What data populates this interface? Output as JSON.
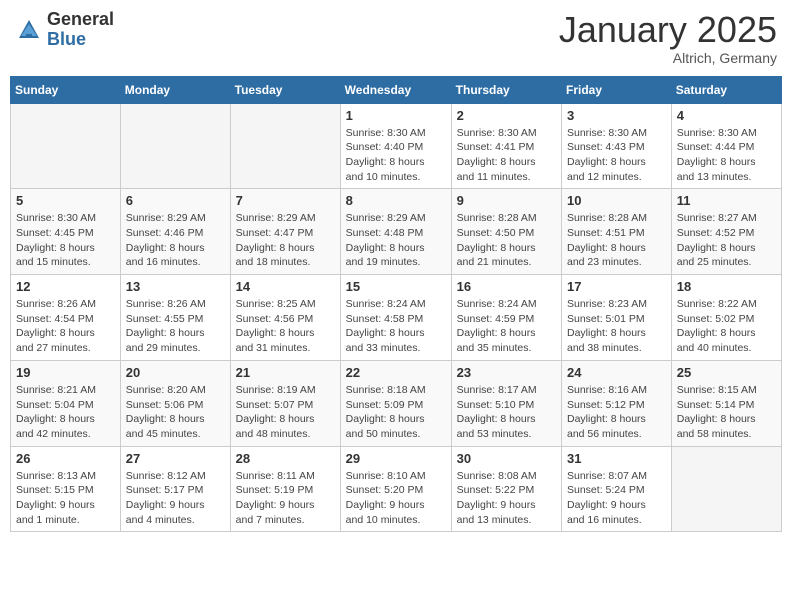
{
  "header": {
    "logo_general": "General",
    "logo_blue": "Blue",
    "month_year": "January 2025",
    "location": "Altrich, Germany"
  },
  "weekdays": [
    "Sunday",
    "Monday",
    "Tuesday",
    "Wednesday",
    "Thursday",
    "Friday",
    "Saturday"
  ],
  "weeks": [
    [
      {
        "day": "",
        "info": ""
      },
      {
        "day": "",
        "info": ""
      },
      {
        "day": "",
        "info": ""
      },
      {
        "day": "1",
        "info": "Sunrise: 8:30 AM\nSunset: 4:40 PM\nDaylight: 8 hours\nand 10 minutes."
      },
      {
        "day": "2",
        "info": "Sunrise: 8:30 AM\nSunset: 4:41 PM\nDaylight: 8 hours\nand 11 minutes."
      },
      {
        "day": "3",
        "info": "Sunrise: 8:30 AM\nSunset: 4:43 PM\nDaylight: 8 hours\nand 12 minutes."
      },
      {
        "day": "4",
        "info": "Sunrise: 8:30 AM\nSunset: 4:44 PM\nDaylight: 8 hours\nand 13 minutes."
      }
    ],
    [
      {
        "day": "5",
        "info": "Sunrise: 8:30 AM\nSunset: 4:45 PM\nDaylight: 8 hours\nand 15 minutes."
      },
      {
        "day": "6",
        "info": "Sunrise: 8:29 AM\nSunset: 4:46 PM\nDaylight: 8 hours\nand 16 minutes."
      },
      {
        "day": "7",
        "info": "Sunrise: 8:29 AM\nSunset: 4:47 PM\nDaylight: 8 hours\nand 18 minutes."
      },
      {
        "day": "8",
        "info": "Sunrise: 8:29 AM\nSunset: 4:48 PM\nDaylight: 8 hours\nand 19 minutes."
      },
      {
        "day": "9",
        "info": "Sunrise: 8:28 AM\nSunset: 4:50 PM\nDaylight: 8 hours\nand 21 minutes."
      },
      {
        "day": "10",
        "info": "Sunrise: 8:28 AM\nSunset: 4:51 PM\nDaylight: 8 hours\nand 23 minutes."
      },
      {
        "day": "11",
        "info": "Sunrise: 8:27 AM\nSunset: 4:52 PM\nDaylight: 8 hours\nand 25 minutes."
      }
    ],
    [
      {
        "day": "12",
        "info": "Sunrise: 8:26 AM\nSunset: 4:54 PM\nDaylight: 8 hours\nand 27 minutes."
      },
      {
        "day": "13",
        "info": "Sunrise: 8:26 AM\nSunset: 4:55 PM\nDaylight: 8 hours\nand 29 minutes."
      },
      {
        "day": "14",
        "info": "Sunrise: 8:25 AM\nSunset: 4:56 PM\nDaylight: 8 hours\nand 31 minutes."
      },
      {
        "day": "15",
        "info": "Sunrise: 8:24 AM\nSunset: 4:58 PM\nDaylight: 8 hours\nand 33 minutes."
      },
      {
        "day": "16",
        "info": "Sunrise: 8:24 AM\nSunset: 4:59 PM\nDaylight: 8 hours\nand 35 minutes."
      },
      {
        "day": "17",
        "info": "Sunrise: 8:23 AM\nSunset: 5:01 PM\nDaylight: 8 hours\nand 38 minutes."
      },
      {
        "day": "18",
        "info": "Sunrise: 8:22 AM\nSunset: 5:02 PM\nDaylight: 8 hours\nand 40 minutes."
      }
    ],
    [
      {
        "day": "19",
        "info": "Sunrise: 8:21 AM\nSunset: 5:04 PM\nDaylight: 8 hours\nand 42 minutes."
      },
      {
        "day": "20",
        "info": "Sunrise: 8:20 AM\nSunset: 5:06 PM\nDaylight: 8 hours\nand 45 minutes."
      },
      {
        "day": "21",
        "info": "Sunrise: 8:19 AM\nSunset: 5:07 PM\nDaylight: 8 hours\nand 48 minutes."
      },
      {
        "day": "22",
        "info": "Sunrise: 8:18 AM\nSunset: 5:09 PM\nDaylight: 8 hours\nand 50 minutes."
      },
      {
        "day": "23",
        "info": "Sunrise: 8:17 AM\nSunset: 5:10 PM\nDaylight: 8 hours\nand 53 minutes."
      },
      {
        "day": "24",
        "info": "Sunrise: 8:16 AM\nSunset: 5:12 PM\nDaylight: 8 hours\nand 56 minutes."
      },
      {
        "day": "25",
        "info": "Sunrise: 8:15 AM\nSunset: 5:14 PM\nDaylight: 8 hours\nand 58 minutes."
      }
    ],
    [
      {
        "day": "26",
        "info": "Sunrise: 8:13 AM\nSunset: 5:15 PM\nDaylight: 9 hours\nand 1 minute."
      },
      {
        "day": "27",
        "info": "Sunrise: 8:12 AM\nSunset: 5:17 PM\nDaylight: 9 hours\nand 4 minutes."
      },
      {
        "day": "28",
        "info": "Sunrise: 8:11 AM\nSunset: 5:19 PM\nDaylight: 9 hours\nand 7 minutes."
      },
      {
        "day": "29",
        "info": "Sunrise: 8:10 AM\nSunset: 5:20 PM\nDaylight: 9 hours\nand 10 minutes."
      },
      {
        "day": "30",
        "info": "Sunrise: 8:08 AM\nSunset: 5:22 PM\nDaylight: 9 hours\nand 13 minutes."
      },
      {
        "day": "31",
        "info": "Sunrise: 8:07 AM\nSunset: 5:24 PM\nDaylight: 9 hours\nand 16 minutes."
      },
      {
        "day": "",
        "info": ""
      }
    ]
  ]
}
